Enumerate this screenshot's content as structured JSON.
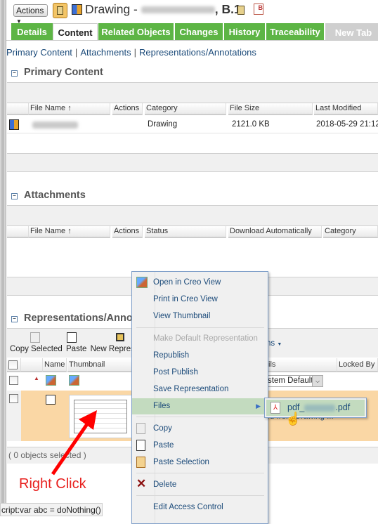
{
  "header": {
    "actions_label": "Actions",
    "title_prefix": "Drawing - ",
    "title_suffix": ", B.1"
  },
  "tabs": [
    "Details",
    "Content",
    "Related Objects",
    "Changes",
    "History",
    "Traceability",
    "New Tab"
  ],
  "active_tab": "Content",
  "subnav": [
    "Primary Content",
    "Attachments",
    "Representations/Annotations"
  ],
  "primary": {
    "title": "Primary Content",
    "columns": [
      "File Name",
      "Actions",
      "Category",
      "File Size",
      "Last Modified"
    ],
    "rows": [
      {
        "category": "Drawing",
        "size": "2121.0 KB",
        "modified": "2018-05-29 21:12"
      }
    ]
  },
  "attachments": {
    "title": "Attachments",
    "columns": [
      "File Name",
      "Actions",
      "Status",
      "Download Automatically",
      "Category"
    ]
  },
  "reps": {
    "title": "Representations/Anno",
    "toolbar": [
      "Copy Selected",
      "Paste",
      "New Represe"
    ],
    "toolbar_more": "ions",
    "columns": [
      "Name",
      "Thumbnail",
      "ils",
      "Locked By"
    ],
    "row1_select": "stem Default",
    "row2_desc": "ied from Drawing ...",
    "footer": "( 0 objects selected )"
  },
  "context_menu": {
    "items": [
      "Open in Creo View",
      "Print in Creo View",
      "View Thumbnail",
      "Make Default Representation",
      "Republish",
      "Post Publish",
      "Save Representation",
      "Files",
      "Copy",
      "Paste",
      "Paste Selection",
      "Delete",
      "Edit Access Control"
    ],
    "highlighted": "Files",
    "disabled": [
      "Make Default Representation"
    ]
  },
  "submenu": {
    "file_prefix": "pdf_",
    "file_suffix": ".pdf"
  },
  "annotation": {
    "text": "Right Click",
    "color": "#e8201e"
  },
  "statusbar": "cript:var abc = doNothing()",
  "colors": {
    "tab_green": "#5db545",
    "link_blue": "#1c4b7a",
    "selected_row": "#fad7a5",
    "menu_highlight": "#c3dbbf"
  }
}
